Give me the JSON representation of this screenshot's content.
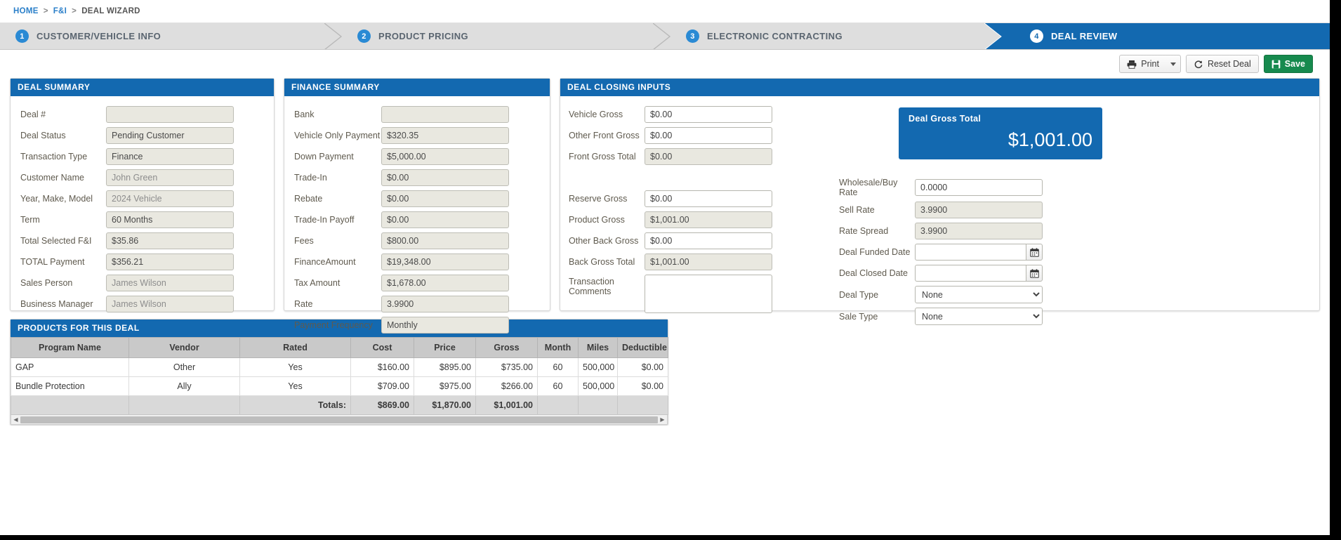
{
  "breadcrumb": {
    "home": "HOME",
    "sep": ">",
    "section": "F&I",
    "current": "DEAL WIZARD"
  },
  "wizard": {
    "steps": [
      {
        "num": "1",
        "label": "CUSTOMER/VEHICLE INFO",
        "active": false
      },
      {
        "num": "2",
        "label": "PRODUCT PRICING",
        "active": false
      },
      {
        "num": "3",
        "label": "ELECTRONIC CONTRACTING",
        "active": false
      },
      {
        "num": "4",
        "label": "DEAL REVIEW",
        "active": true
      }
    ]
  },
  "toolbar": {
    "print_label": "Print",
    "reset_label": "Reset Deal",
    "save_label": "Save"
  },
  "deal_summary": {
    "title": "DEAL SUMMARY",
    "fields": [
      {
        "label": "Deal #",
        "value": ""
      },
      {
        "label": "Deal Status",
        "value": "Pending Customer"
      },
      {
        "label": "Transaction Type",
        "value": "Finance"
      },
      {
        "label": "Customer Name",
        "value": "John Green"
      },
      {
        "label": "Year, Make, Model",
        "value": "2024 Vehicle"
      },
      {
        "label": "Term",
        "value": "60 Months"
      },
      {
        "label": "Total Selected F&I",
        "value": "$35.86"
      },
      {
        "label": "TOTAL Payment",
        "value": "$356.21"
      },
      {
        "label": "Sales Person",
        "value": "James Wilson"
      },
      {
        "label": "Business Manager",
        "value": "James Wilson"
      }
    ]
  },
  "finance_summary": {
    "title": "FINANCE SUMMARY",
    "fields": [
      {
        "label": "Bank",
        "value": ""
      },
      {
        "label": "Vehicle Only Payment",
        "value": "$320.35"
      },
      {
        "label": "Down Payment",
        "value": "$5,000.00"
      },
      {
        "label": "Trade-In",
        "value": "$0.00"
      },
      {
        "label": "Rebate",
        "value": "$0.00"
      },
      {
        "label": "Trade-In Payoff",
        "value": "$0.00"
      },
      {
        "label": "Fees",
        "value": "$800.00"
      },
      {
        "label": "FinanceAmount",
        "value": "$19,348.00"
      },
      {
        "label": "Tax Amount",
        "value": "$1,678.00"
      },
      {
        "label": "Rate",
        "value": "3.9900"
      },
      {
        "label": "Payment Frequency",
        "value": "Monthly"
      }
    ]
  },
  "deal_closing": {
    "title": "DEAL CLOSING INPUTS",
    "left": {
      "vehicle_gross_label": "Vehicle Gross",
      "vehicle_gross_value": "$0.00",
      "other_front_gross_label": "Other Front Gross",
      "other_front_gross_value": "$0.00",
      "front_gross_total_label": "Front Gross Total",
      "front_gross_total_value": "$0.00",
      "reserve_gross_label": "Reserve Gross",
      "reserve_gross_value": "$0.00",
      "product_gross_label": "Product Gross",
      "product_gross_value": "$1,001.00",
      "other_back_gross_label": "Other Back Gross",
      "other_back_gross_value": "$0.00",
      "back_gross_total_label": "Back Gross Total",
      "back_gross_total_value": "$1,001.00",
      "transaction_comments_label": "Transaction Comments",
      "transaction_comments_value": ""
    },
    "gross_total": {
      "label": "Deal Gross Total",
      "value": "$1,001.00"
    },
    "right": {
      "wholesale_rate_label": "Wholesale/Buy Rate",
      "wholesale_rate_value": "0.0000",
      "sell_rate_label": "Sell Rate",
      "sell_rate_value": "3.9900",
      "rate_spread_label": "Rate Spread",
      "rate_spread_value": "3.9900",
      "deal_funded_date_label": "Deal Funded Date",
      "deal_funded_date_value": "",
      "deal_closed_date_label": "Deal Closed Date",
      "deal_closed_date_value": "",
      "deal_type_label": "Deal Type",
      "deal_type_value": "None",
      "sale_type_label": "Sale Type",
      "sale_type_value": "None"
    }
  },
  "products": {
    "title": "PRODUCTS FOR THIS DEAL",
    "columns": [
      "Program Name",
      "Vendor",
      "Rated",
      "Cost",
      "Price",
      "Gross",
      "Month",
      "Miles",
      "Deductible"
    ],
    "rows": [
      {
        "program": "GAP",
        "vendor": "Other",
        "rated": "Yes",
        "cost": "$160.00",
        "price": "$895.00",
        "gross": "$735.00",
        "month": "60",
        "miles": "500,000",
        "deductible": "$0.00"
      },
      {
        "program": "Bundle Protection",
        "vendor": "Ally",
        "rated": "Yes",
        "cost": "$709.00",
        "price": "$975.00",
        "gross": "$266.00",
        "month": "60",
        "miles": "500,000",
        "deductible": "$0.00"
      }
    ],
    "totals": {
      "label": "Totals:",
      "cost": "$869.00",
      "price": "$1,870.00",
      "gross": "$1,001.00"
    }
  },
  "colors": {
    "brand_blue": "#1369b0",
    "step_blue": "#2a8ad4",
    "save_green": "#168a4e",
    "panel_grey": "#dedede",
    "field_beige": "#e9e8e0"
  }
}
